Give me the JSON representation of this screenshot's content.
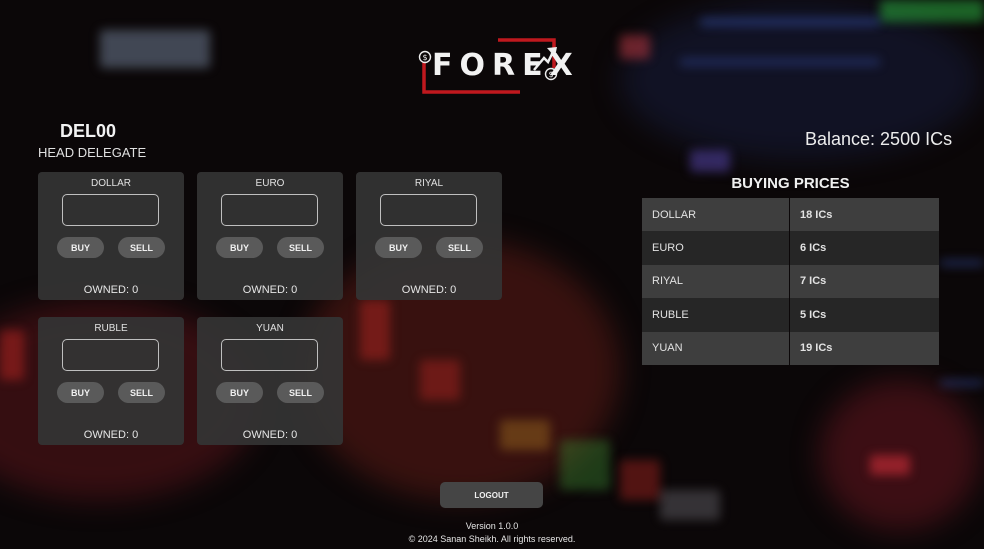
{
  "logo": {
    "text": "FOREX"
  },
  "user": {
    "name": "DEL00",
    "role": "HEAD DELEGATE"
  },
  "balance": "Balance: 2500 ICs",
  "currencies": [
    {
      "name": "DOLLAR",
      "owned": "OWNED: 0"
    },
    {
      "name": "EURO",
      "owned": "OWNED: 0"
    },
    {
      "name": "RIYAL",
      "owned": "OWNED: 0"
    },
    {
      "name": "RUBLE",
      "owned": "OWNED: 0"
    },
    {
      "name": "YUAN",
      "owned": "OWNED: 0"
    }
  ],
  "buttons": {
    "buy": "BUY",
    "sell": "SELL",
    "logout": "LOGOUT"
  },
  "prices": {
    "title": "BUYING PRICES",
    "rows": [
      {
        "currency": "DOLLAR",
        "price": "18 ICs"
      },
      {
        "currency": "EURO",
        "price": "6 ICs"
      },
      {
        "currency": "RIYAL",
        "price": "7 ICs"
      },
      {
        "currency": "RUBLE",
        "price": "5 ICs"
      },
      {
        "currency": "YUAN",
        "price": "19 ICs"
      }
    ]
  },
  "footer": {
    "version": "Version 1.0.0",
    "copyright": "© 2024 Sanan Sheikh. All rights reserved."
  },
  "colors": {
    "background": "#0b0708",
    "card": "#343434",
    "accent_red": "#c0181e",
    "button": "#5a5a5a"
  }
}
